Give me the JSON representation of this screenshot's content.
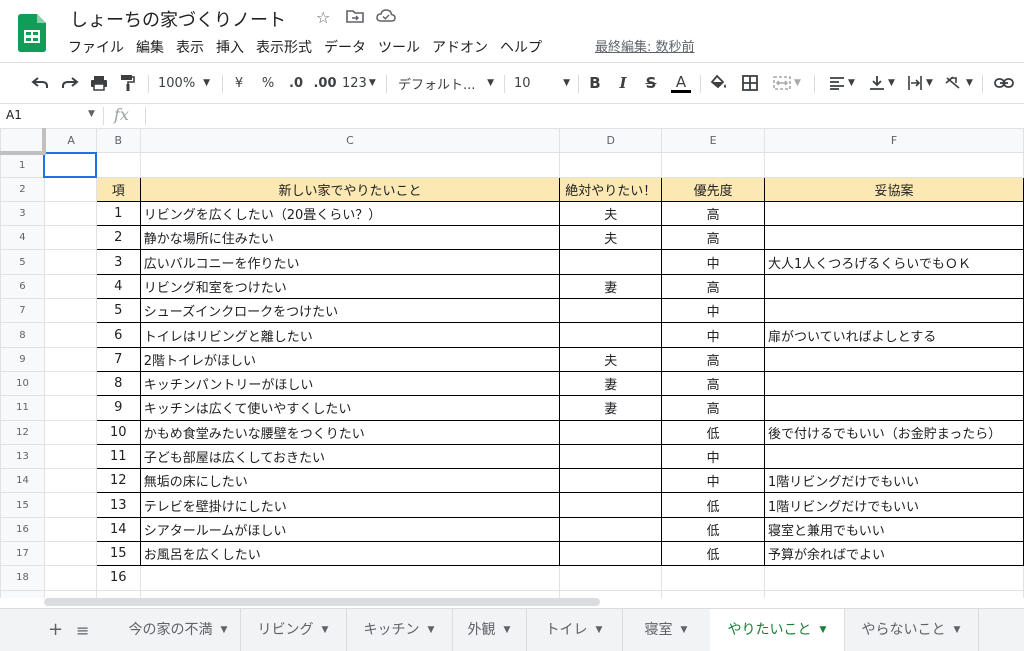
{
  "app": {
    "title": "しょーちの家づくりノート",
    "last_edit": "最終編集: 数秒前",
    "star_icon": "star-icon",
    "colors": {
      "accent": "#1a73e8",
      "header_fill": "#fce8b2",
      "active_tab": "#188038",
      "logo": "#0f9d58"
    }
  },
  "menu": [
    "ファイル",
    "編集",
    "表示",
    "挿入",
    "表示形式",
    "データ",
    "ツール",
    "アドオン",
    "ヘルプ"
  ],
  "toolbar": {
    "zoom": "100%",
    "currency": "¥",
    "percent": "%",
    "dec_decrease": ".0",
    "dec_increase": ".00",
    "more_formats": "123",
    "font": "デフォルト...",
    "font_size": "10",
    "bold": "B",
    "italic": "I",
    "strike": "S",
    "text_color": "A"
  },
  "formula_bar": {
    "cell": "A1",
    "fx": "fx",
    "value": ""
  },
  "columns": [
    "A",
    "B",
    "C",
    "D",
    "E",
    "F"
  ],
  "row_numbers": [
    "1",
    "2",
    "3",
    "4",
    "5",
    "6",
    "7",
    "8",
    "9",
    "10",
    "11",
    "12",
    "13",
    "14",
    "15",
    "16",
    "17",
    "18"
  ],
  "table": {
    "headers": [
      "項",
      "新しい家でやりたいこと",
      "絶対やりたい！",
      "優先度",
      "妥協案"
    ],
    "rows": [
      [
        "1",
        "リビングを広くしたい（20畳くらい？）",
        "夫",
        "高",
        ""
      ],
      [
        "2",
        "静かな場所に住みたい",
        "夫",
        "高",
        ""
      ],
      [
        "3",
        "広いバルコニーを作りたい",
        "",
        "中",
        "大人1人くつろげるくらいでもＯＫ"
      ],
      [
        "4",
        "リビング和室をつけたい",
        "妻",
        "高",
        ""
      ],
      [
        "5",
        "シューズインクロークをつけたい",
        "",
        "中",
        ""
      ],
      [
        "6",
        "トイレはリビングと離したい",
        "",
        "中",
        "扉がついていればよしとする"
      ],
      [
        "7",
        "2階トイレがほしい",
        "夫",
        "高",
        ""
      ],
      [
        "8",
        "キッチンパントリーがほしい",
        "妻",
        "高",
        ""
      ],
      [
        "9",
        "キッチンは広くて使いやすくしたい",
        "妻",
        "高",
        ""
      ],
      [
        "10",
        "かもめ食堂みたいな腰壁をつくりたい",
        "",
        "低",
        "後で付けるでもいい（お金貯まったら）"
      ],
      [
        "11",
        "子ども部屋は広くしておきたい",
        "",
        "中",
        ""
      ],
      [
        "12",
        "無垢の床にしたい",
        "",
        "中",
        "1階リビングだけでもいい"
      ],
      [
        "13",
        "テレビを壁掛けにしたい",
        "",
        "低",
        "1階リビングだけでもいい"
      ],
      [
        "14",
        "シアタールームがほしい",
        "",
        "低",
        "寝室と兼用でもいい"
      ],
      [
        "15",
        "お風呂を広くしたい",
        "",
        "低",
        "予算が余ればでよい"
      ],
      [
        "16",
        "",
        "",
        "",
        ""
      ]
    ]
  },
  "sheets": {
    "tabs": [
      "今の家の不満",
      "リビング",
      "キッチン",
      "外観",
      "トイレ",
      "寝室",
      "やりたいこと",
      "やらないこと"
    ],
    "active": "やりたいこと"
  }
}
